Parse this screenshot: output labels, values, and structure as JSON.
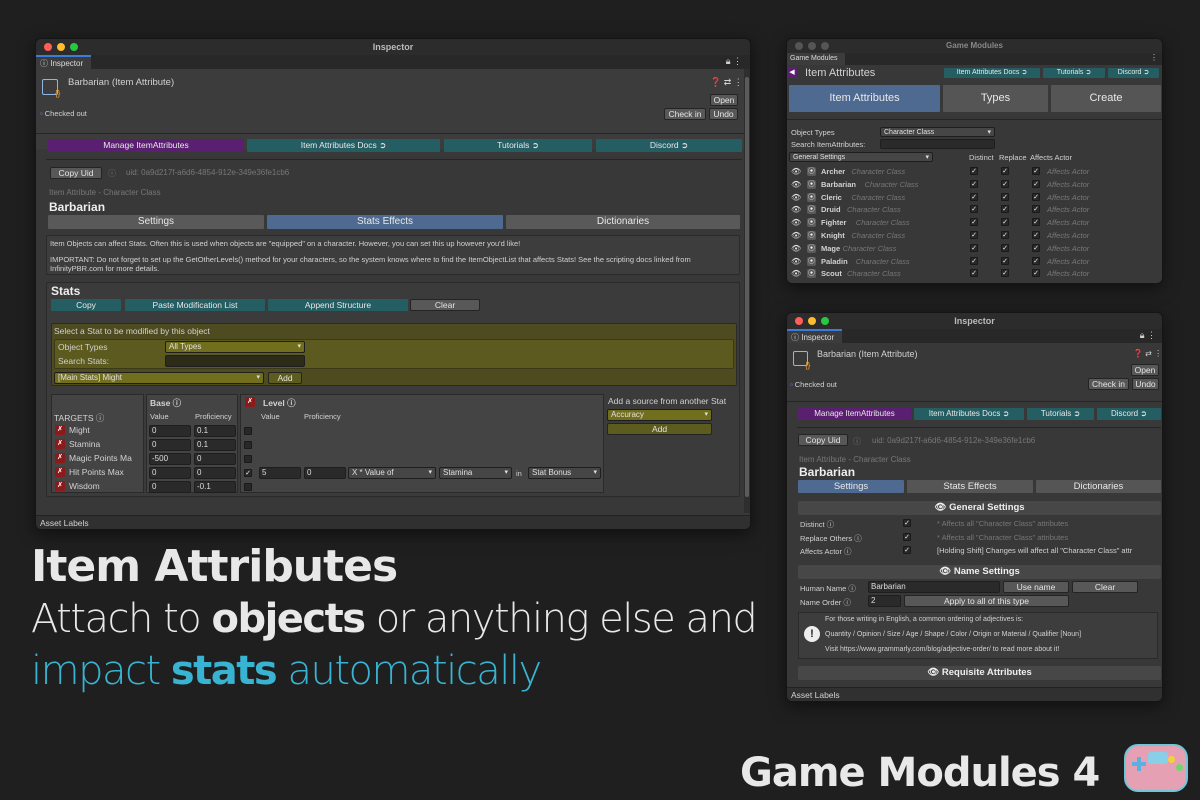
{
  "main_inspector": {
    "title": "Inspector",
    "tab": "Inspector",
    "object_name": "Barbarian (Item Attribute)",
    "checked_out": "Checked out",
    "open": "Open",
    "check_in": "Check in",
    "undo": "Undo",
    "nav": [
      "Manage ItemAttributes",
      "Item Attributes Docs ➲",
      "Tutorials ➲",
      "Discord ➲"
    ],
    "copy_uid": "Copy Uid",
    "uid": "uid: 0a9d217f-a6d6-4854-912e-349e36fe1cb6",
    "subtitle": "Item Attribute - Character Class",
    "name": "Barbarian",
    "tabs": [
      "Settings",
      "Stats Effects",
      "Dictionaries"
    ],
    "info1": "Item Objects can affect Stats. Often this is used when objects are \"equipped\" on a character. However, you can set this up however you'd like!",
    "info2": "IMPORTANT: Do not forget to set up the GetOtherLevels() method for your characters, so the system knows where to find the ItemObjectList that affects Stats! See the scripting docs linked from InfinityPBR.com for more details.",
    "stats_title": "Stats",
    "stat_btns": [
      "Copy",
      "Paste Modification List",
      "Append Structure",
      "Clear"
    ],
    "select_label": "Select a Stat to be modified by this object",
    "object_types_label": "Object Types",
    "object_types_value": "All Types",
    "search_label": "Search Stats:",
    "stat_choice": "[Main Stats] Might",
    "add": "Add",
    "targets_label": "TARGETS ⓘ",
    "targets": [
      "Might",
      "Stamina",
      "Magic Points Ma",
      "Hit Points Max",
      "Wisdom"
    ],
    "base_label": "Base ⓘ",
    "level_label": "Level ⓘ",
    "value": "Value",
    "proficiency": "Proficiency",
    "base_values": [
      [
        "0",
        "0.1"
      ],
      [
        "0",
        "0.1"
      ],
      [
        "-500",
        "0"
      ],
      [
        "0",
        "0"
      ],
      [
        "0",
        "-0.1"
      ]
    ],
    "level_row": {
      "v": "5",
      "p": "0",
      "op": "X * Value of",
      "stat": "Stamina",
      "in": "in",
      "src": "Stat Bonus"
    },
    "add_source": "Add a source from another Stat",
    "accuracy": "Accuracy",
    "add2": "Add",
    "asset_labels": "Asset Labels"
  },
  "game_modules": {
    "title": "Game Modules",
    "tab": "Game Modules",
    "header": "Item Attributes",
    "links": [
      "Item Attributes Docs ➲",
      "Tutorials ➲",
      "Discord ➲"
    ],
    "big_tabs": [
      "Item Attributes",
      "Types",
      "Create"
    ],
    "object_types_label": "Object Types",
    "object_types_value": "Character Class",
    "search_label": "Search ItemAttributes:",
    "general_settings": "General Settings",
    "cols": [
      "Distinct",
      "Replace",
      "Affects Actor"
    ],
    "rows": [
      "Archer",
      "Barbarian",
      "Cleric",
      "Druid",
      "Fighter",
      "Knight",
      "Mage",
      "Paladin",
      "Scout"
    ],
    "row_type": "Character Class",
    "affects_actor": "Affects Actor"
  },
  "small_inspector": {
    "title": "Inspector",
    "tab": "Inspector",
    "object_name": "Barbarian (Item Attribute)",
    "checked_out": "Checked out",
    "open": "Open",
    "check_in": "Check in",
    "undo": "Undo",
    "nav": [
      "Manage ItemAttributes",
      "Item Attributes Docs ➲",
      "Tutorials ➲",
      "Discord ➲"
    ],
    "copy_uid": "Copy Uid",
    "uid": "uid: 0a9d217f-a6d6-4854-912e-349e36fe1cb6",
    "subtitle": "Item Attribute - Character Class",
    "name": "Barbarian",
    "tabs": [
      "Settings",
      "Stats Effects",
      "Dictionaries"
    ],
    "general_settings": "👁 General Settings",
    "distinct": "Distinct ⓘ",
    "replace_others": "Replace Others ⓘ",
    "affects_actor": "Affects Actor ⓘ",
    "distinct_note": "* Affects all \"Character Class\" attributes",
    "replace_note": "* Affects all \"Character Class\" attributes",
    "affects_note": "[Holding Shift] Changes will affect all \"Character Class\" attr",
    "name_settings": "👁 Name Settings",
    "human_name_label": "Human Name ⓘ",
    "human_name": "Barbarian",
    "use_name": "Use name",
    "clear": "Clear",
    "name_order_label": "Name Order ⓘ",
    "name_order": "2",
    "apply": "Apply to all of this type",
    "tip1": "For those writing in English, a common ordering of adjectives is:",
    "tip2": "Quantity / Opinion / Size / Age / Shape / Color / Origin or Material / Qualifier [Noun]",
    "tip3": "Visit https://www.grammarly.com/blog/adjective-order/ to read more about it!",
    "requisite": "👁 Requisite Attributes",
    "asset_labels": "Asset Labels"
  },
  "headline": {
    "l1": "Item Attributes",
    "l2a": "Attach to ",
    "l2b": "objects",
    "l2c": " or anything else and",
    "l3a": "impact ",
    "l3b": "stats",
    "l3c": " automatically"
  },
  "brand": "Game Modules 4"
}
